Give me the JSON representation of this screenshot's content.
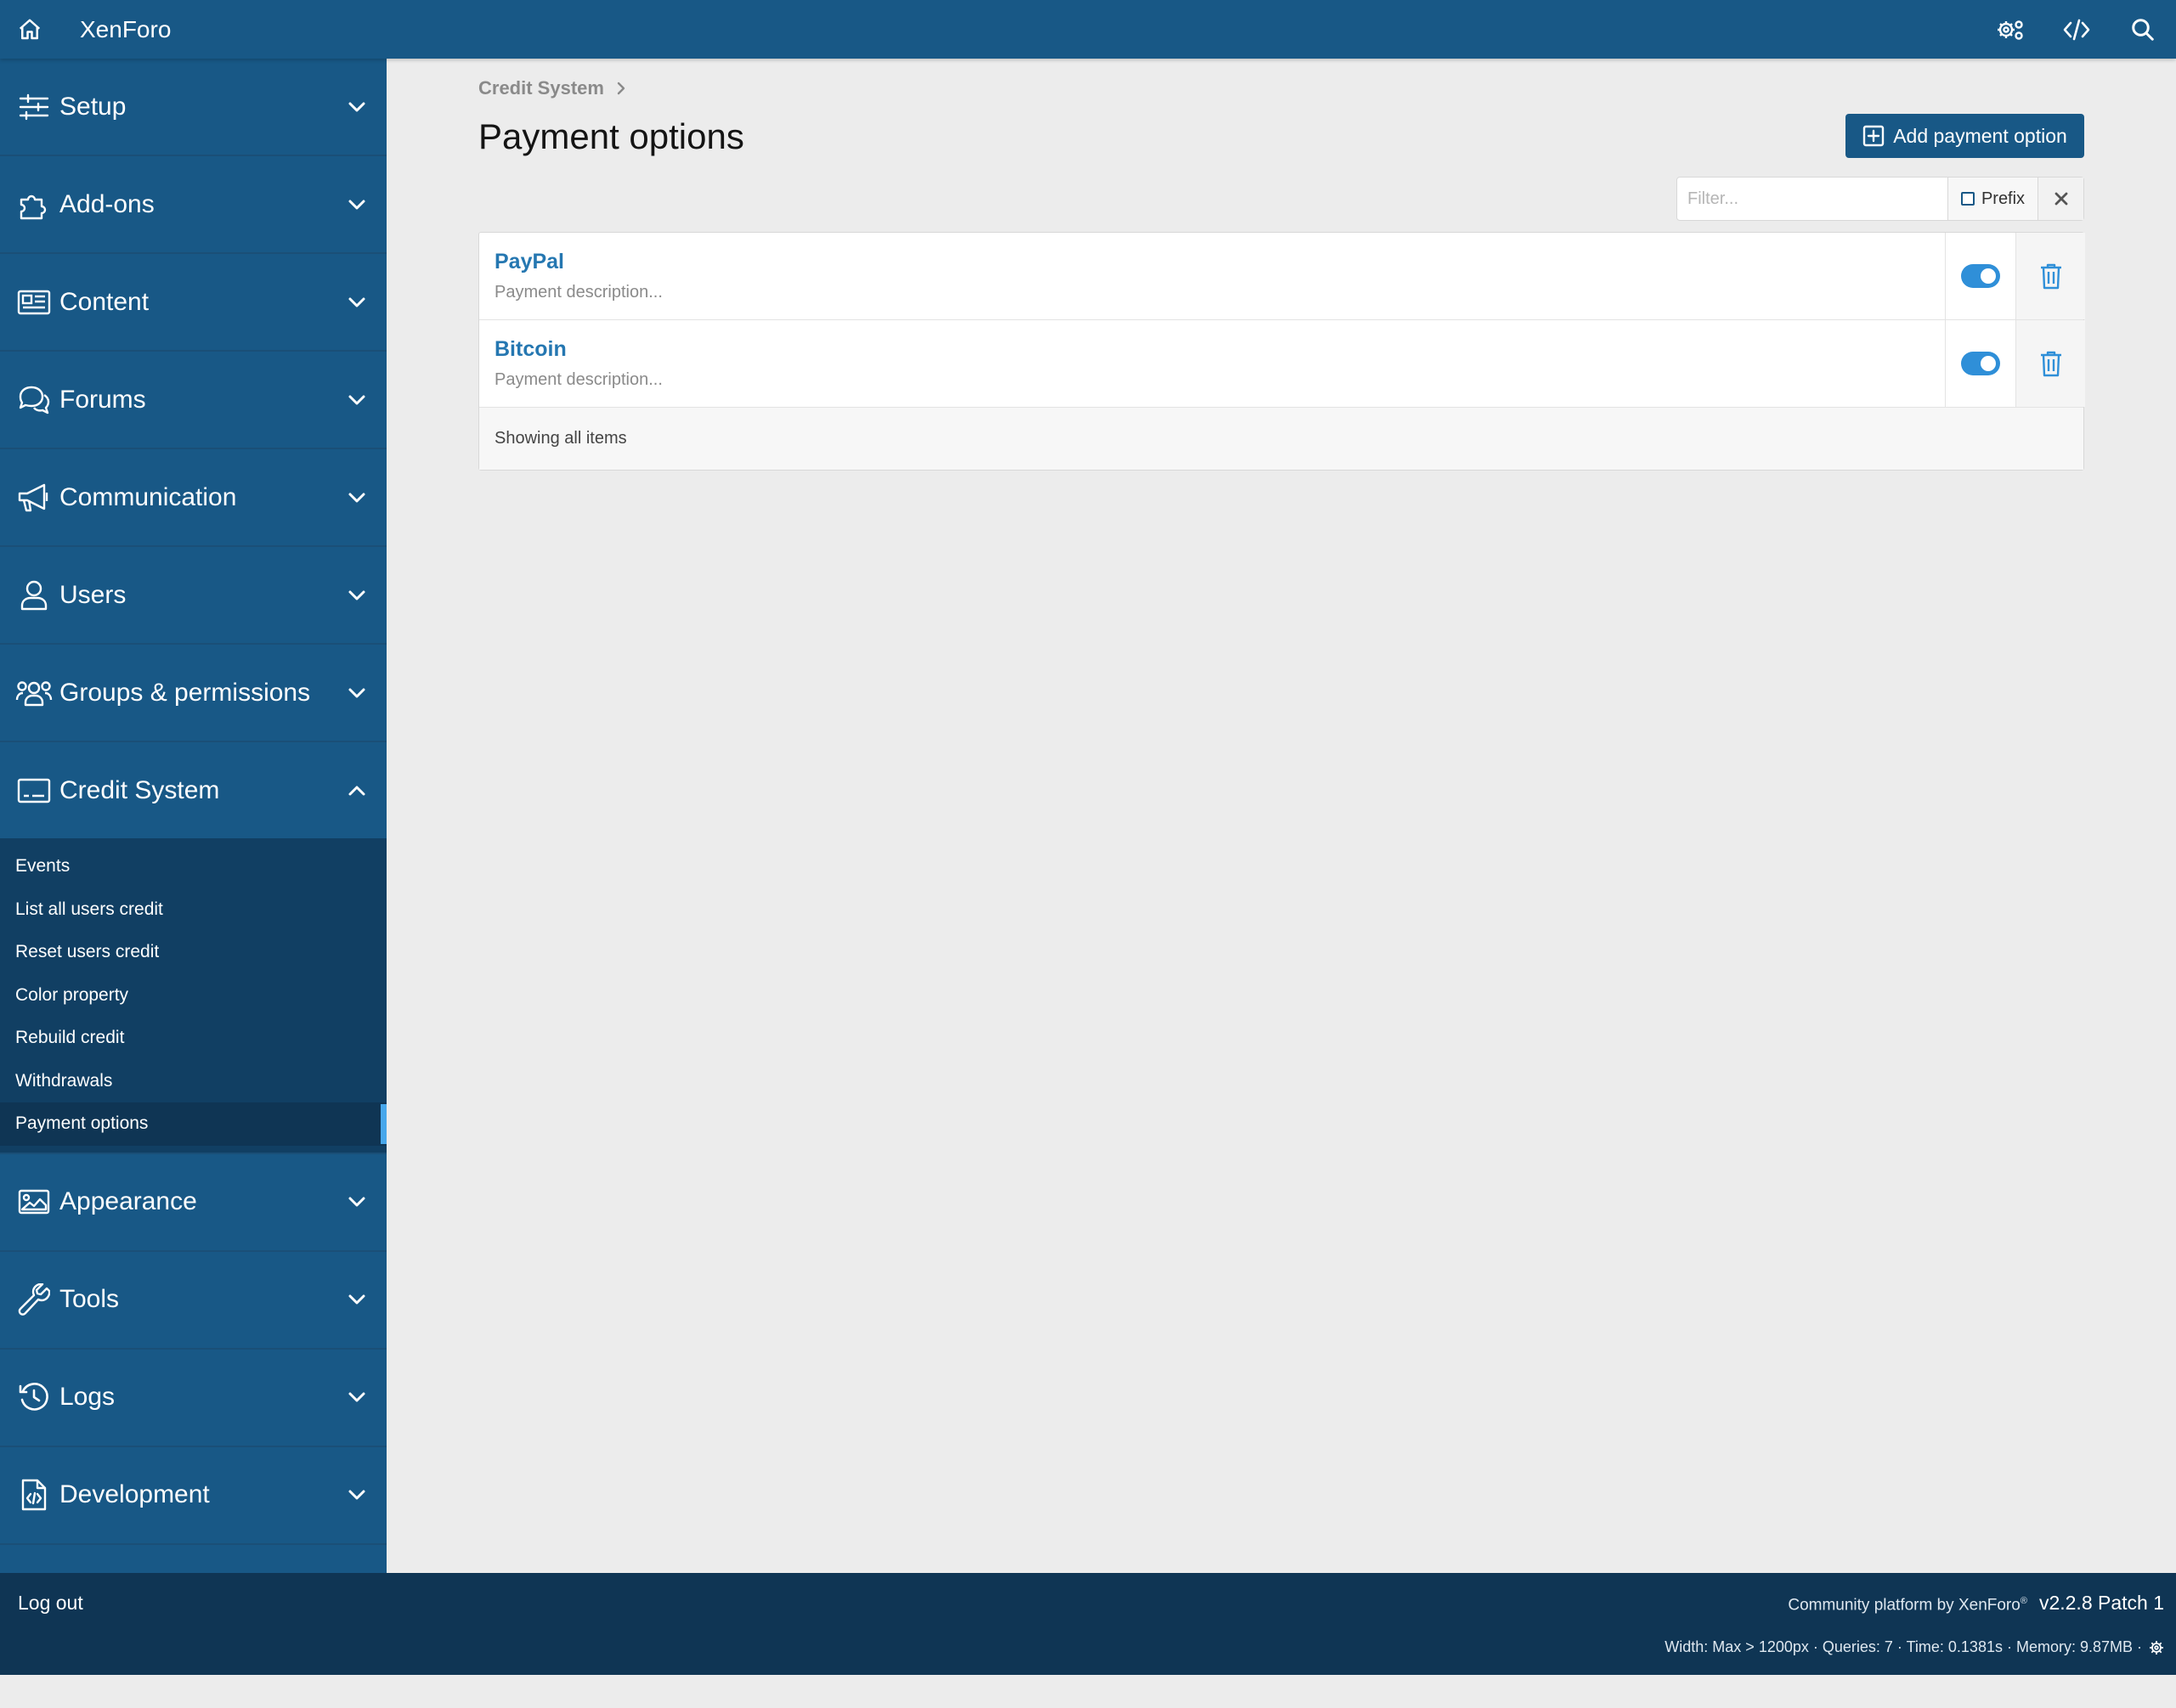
{
  "header": {
    "brand": "XenForo",
    "home_icon": "home-icon",
    "actions": [
      "settings-icon",
      "code-icon",
      "search-icon"
    ]
  },
  "sidebar": {
    "sections": [
      {
        "label": "Setup",
        "icon": "sliders-icon"
      },
      {
        "label": "Add-ons",
        "icon": "puzzle-icon"
      },
      {
        "label": "Content",
        "icon": "newspaper-icon"
      },
      {
        "label": "Forums",
        "icon": "comments-icon"
      },
      {
        "label": "Communication",
        "icon": "megaphone-icon"
      },
      {
        "label": "Users",
        "icon": "user-icon"
      },
      {
        "label": "Groups & permissions",
        "icon": "users-icon"
      },
      {
        "label": "Credit System",
        "icon": "keyboard-icon",
        "expanded": true
      },
      {
        "label": "Appearance",
        "icon": "image-icon"
      },
      {
        "label": "Tools",
        "icon": "wrench-icon"
      },
      {
        "label": "Logs",
        "icon": "history-icon"
      },
      {
        "label": "Development",
        "icon": "code-file-icon"
      }
    ],
    "credit_items": [
      "Events",
      "List all users credit",
      "Reset users credit",
      "Color property",
      "Rebuild credit",
      "Withdrawals",
      "Payment options"
    ],
    "active_item": "Payment options"
  },
  "main": {
    "breadcrumb": "Credit System",
    "title": "Payment options",
    "add_button": "Add payment option",
    "filter": {
      "placeholder": "Filter...",
      "prefix_label": "Prefix"
    },
    "rows": [
      {
        "title": "PayPal",
        "description": "Payment description...",
        "enabled": true
      },
      {
        "title": "Bitcoin",
        "description": "Payment description...",
        "enabled": true
      }
    ],
    "list_footer": "Showing all items"
  },
  "footer": {
    "logout": "Log out",
    "credit": "Community platform by XenForo",
    "registered": "®",
    "version": "v2.2.8 Patch 1",
    "debug": "Width: Max > 1200px · Queries: 7 · Time: 0.1381s · Memory: 9.87MB ·"
  },
  "colors": {
    "header": "#185886",
    "footer": "#0f3554",
    "accent": "#47a7eb",
    "link": "#2577b1",
    "toggle_on": "#2f8fd8"
  }
}
